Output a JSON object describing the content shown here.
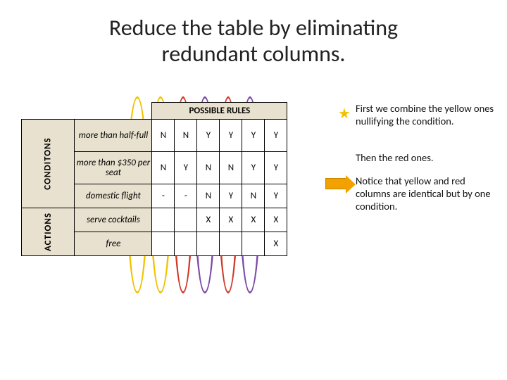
{
  "title_line1": "Reduce the table by eliminating",
  "title_line2": "redundant columns.",
  "header_rules": "POSSIBLE RULES",
  "labels": {
    "conditions": "CONDITONS",
    "actions": "ACTIONS"
  },
  "rows": {
    "r1": {
      "label": "more than half-full",
      "c": [
        "N",
        "N",
        "Y",
        "Y",
        "Y",
        "Y"
      ]
    },
    "r2": {
      "label": "more than $350 per seat",
      "c": [
        "N",
        "Y",
        "N",
        "N",
        "Y",
        "Y"
      ]
    },
    "r3": {
      "label": "domestic flight",
      "c": [
        "-",
        "-",
        "N",
        "Y",
        "N",
        "Y"
      ]
    },
    "r4": {
      "label": "serve cocktails",
      "c": [
        "",
        "",
        "X",
        "X",
        "X",
        "X"
      ]
    },
    "r5": {
      "label": "free",
      "c": [
        "",
        "",
        "",
        "",
        "",
        "X"
      ]
    }
  },
  "notes": {
    "n1": "First we combine the yellow ones nullifying the condition.",
    "n2": "Then the red ones.",
    "n3": "Notice  that yellow and red columns are identical but by one condition."
  },
  "oval_colors": {
    "yellow": "#f2c200",
    "red": "#d03a2a",
    "purple": "#7d4aa8"
  }
}
